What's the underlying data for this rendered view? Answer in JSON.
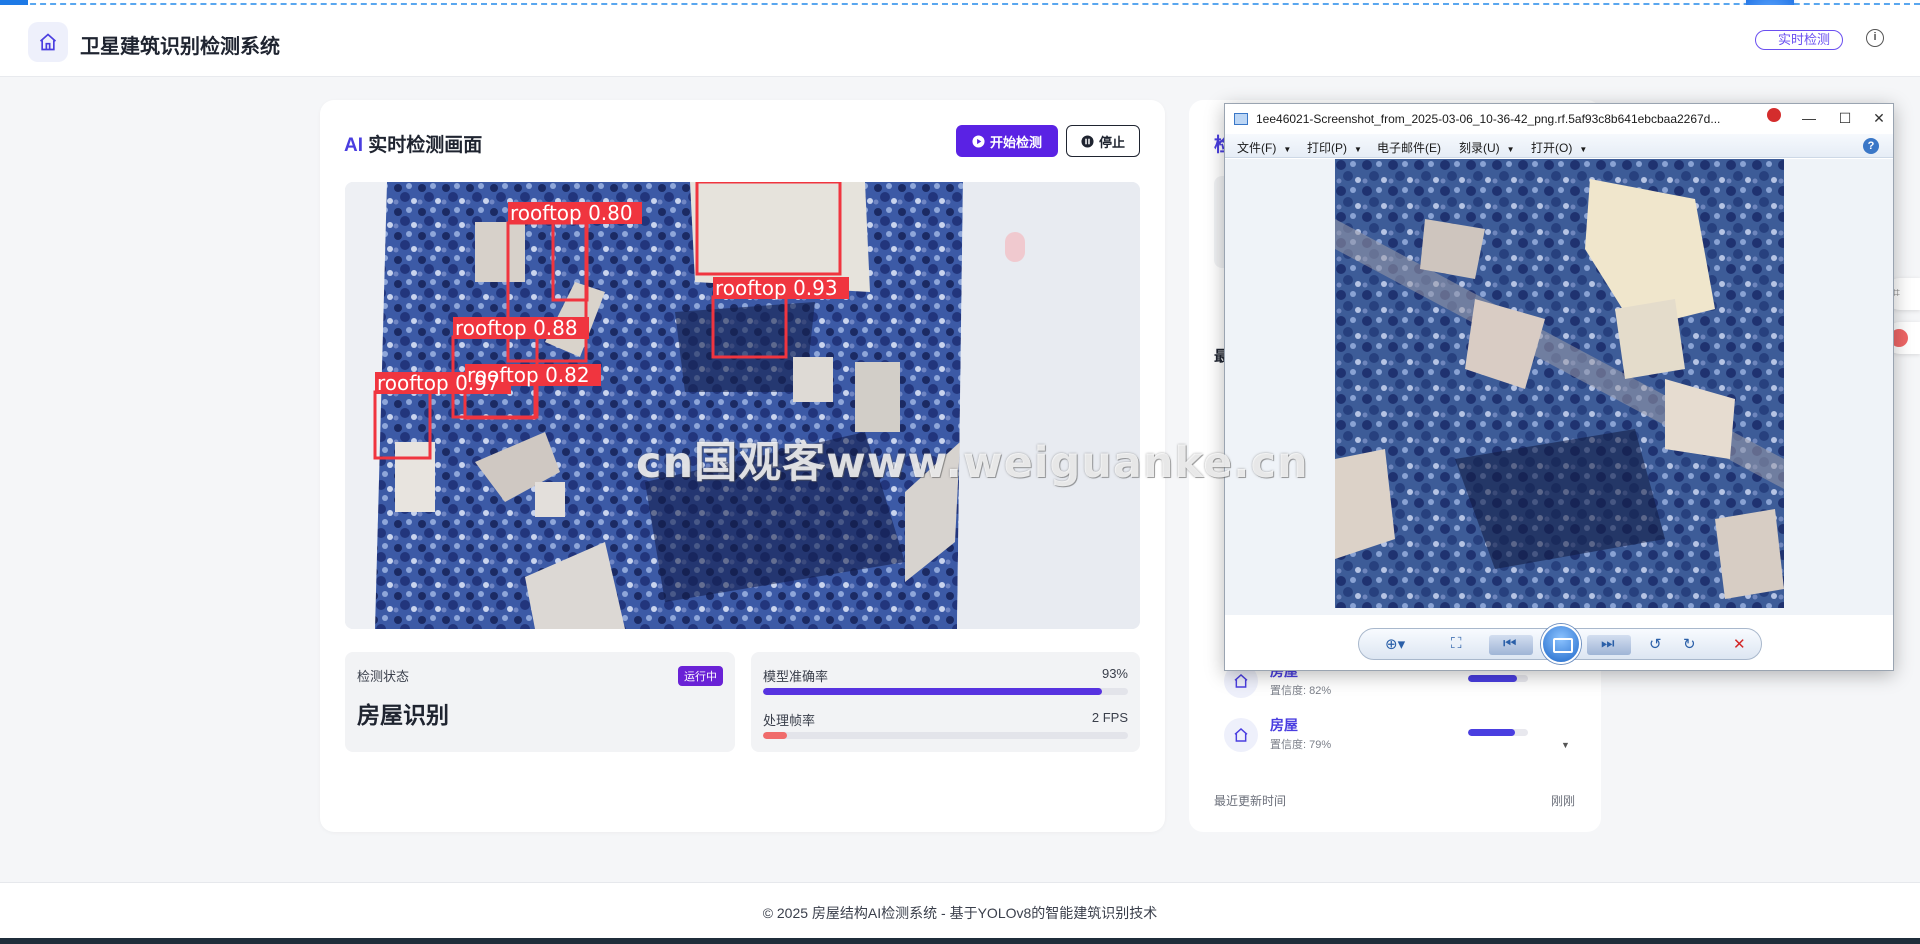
{
  "header": {
    "title": "卫星建筑识别检测系统",
    "pill": "实时检测",
    "info_icon": "i"
  },
  "detection_card": {
    "title_ai": "AI",
    "title_rest": " 实时检测画面",
    "start_label": "开始检测",
    "stop_label": "停止",
    "feed_labels": [
      "rooftop 0.80",
      "rooftop 0.93",
      "rooftop 0.88",
      "rooftop 0.82",
      "rooftop 0.97"
    ],
    "status": {
      "label": "检测状态",
      "badge": "运行中",
      "value": "房屋识别"
    },
    "metrics": [
      {
        "name": "模型准确率",
        "value": "93%",
        "fraction": 0.93,
        "color": "#5733e0"
      },
      {
        "name": "处理帧率",
        "value": "2 FPS",
        "fraction": 0.065,
        "color": "#f06b6b"
      }
    ]
  },
  "side_card": {
    "heading_fragment": "检",
    "subheading_fragment": "最",
    "items": [
      {
        "name": "房屋",
        "confidence": "置信度: 82%",
        "fraction": 0.82
      },
      {
        "name": "房屋",
        "confidence": "置信度: 79%",
        "fraction": 0.79
      }
    ],
    "updated_label": "最近更新时间",
    "updated_value": "刚刚"
  },
  "viewer": {
    "title": "1ee46021-Screenshot_from_2025-03-06_10-36-42_png.rf.5af93c8b641ebcbaa2267d...",
    "menus": [
      "文件(F)",
      "打印(P)",
      "电子邮件(E)",
      "刻录(U)",
      "打开(O)"
    ]
  },
  "watermark": "cn国观客www.weiguanke.cn",
  "footer": {
    "text": "© 2025 房屋结构AI检测系统 - 基于YOLOv8的智能建筑识别技术"
  }
}
